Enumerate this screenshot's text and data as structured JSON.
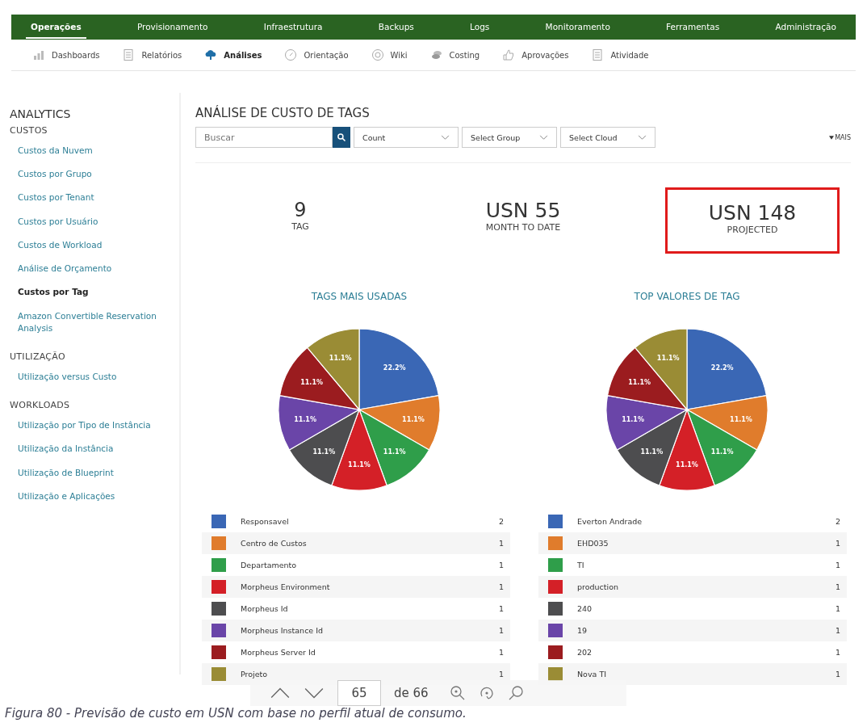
{
  "top_nav": [
    {
      "label": "Operações",
      "selected": true
    },
    {
      "label": "Provisionamento",
      "selected": false
    },
    {
      "label": "Infraestrutura",
      "selected": false
    },
    {
      "label": "Backups",
      "selected": false
    },
    {
      "label": "Logs",
      "selected": false
    },
    {
      "label": "Monitoramento",
      "selected": false
    },
    {
      "label": "Ferramentas",
      "selected": false
    },
    {
      "label": "Administração",
      "selected": false
    }
  ],
  "sub_nav": [
    {
      "label": "Dashboards",
      "kind": "chart",
      "selected": false
    },
    {
      "label": "Relatórios",
      "kind": "doc",
      "selected": false
    },
    {
      "label": "Análises",
      "kind": "cloud",
      "selected": true
    },
    {
      "label": "Orientação",
      "kind": "compass",
      "selected": false
    },
    {
      "label": "Wiki",
      "kind": "wiki",
      "selected": false
    },
    {
      "label": "Costing",
      "kind": "coins",
      "selected": false
    },
    {
      "label": "Aprovações",
      "kind": "thumb",
      "selected": false
    },
    {
      "label": "Atividade",
      "kind": "doc",
      "selected": false
    }
  ],
  "sidebar": {
    "title": "ANALYTICS",
    "sections": [
      {
        "heading": "CUSTOS",
        "items": [
          {
            "label": "Custos da Nuvem",
            "selected": false
          },
          {
            "label": "Custos por Grupo",
            "selected": false
          },
          {
            "label": "Custos por Tenant",
            "selected": false
          },
          {
            "label": "Custos por Usuário",
            "selected": false
          },
          {
            "label": "Custos de Workload",
            "selected": false
          },
          {
            "label": "Análise de Orçamento",
            "selected": false
          },
          {
            "label": "Custos por Tag",
            "selected": true
          },
          {
            "label": "Amazon Convertible Reservation Analysis",
            "selected": false
          }
        ]
      },
      {
        "heading": "UTILIZAÇÃO",
        "items": [
          {
            "label": "Utilização versus Custo",
            "selected": false
          }
        ]
      },
      {
        "heading": "WORKLOADS",
        "items": [
          {
            "label": "Utilização por Tipo de Instância",
            "selected": false
          },
          {
            "label": "Utilização da Instância",
            "selected": false
          },
          {
            "label": "Utilização de Blueprint",
            "selected": false
          },
          {
            "label": "Utilização e Aplicações",
            "selected": false
          }
        ]
      }
    ]
  },
  "content": {
    "title": "ANÁLISE DE CUSTO DE TAGS",
    "search": {
      "placeholder": "Buscar"
    },
    "selects": [
      "Count",
      "Select Group",
      "Select Cloud"
    ],
    "more_link": "MAIS",
    "stats": [
      {
        "value": "9",
        "label": "TAG",
        "highlighted": false
      },
      {
        "value": "USN 55",
        "label": "MONTH TO DATE",
        "highlighted": false
      },
      {
        "value": "USN 148",
        "label": "PROJECTED",
        "highlighted": true
      }
    ],
    "charts": [
      {
        "chart_data": {
          "type": "pie",
          "title": "TAGS MAIS USADAS",
          "categories": [
            "Responsavel",
            "Centro de Custos",
            "Departamento",
            "Morpheus Environment",
            "Morpheus Id",
            "Morpheus Instance Id",
            "Morpheus Server Id",
            "Projeto"
          ],
          "values": [
            22.2,
            11.1,
            11.1,
            11.1,
            11.1,
            11.1,
            11.1,
            11.1
          ],
          "data_labels": true,
          "value_labels": [
            "22.2%",
            "11.1%",
            "11.1%",
            "11.1%",
            "11.1%",
            "11.1%",
            "11.1%",
            "11.1%"
          ]
        },
        "legend": [
          {
            "count": "2",
            "color": "#3a67b5"
          },
          {
            "count": "1",
            "color": "#e07c2c"
          },
          {
            "count": "1",
            "color": "#2f9e4a"
          },
          {
            "count": "1",
            "color": "#d42027"
          },
          {
            "count": "1",
            "color": "#4d4d4f"
          },
          {
            "count": "1",
            "color": "#6a45a8"
          },
          {
            "count": "1",
            "color": "#9b1c1f"
          },
          {
            "count": "1",
            "color": "#9a8c35"
          }
        ]
      },
      {
        "chart_data": {
          "type": "pie",
          "title": "TOP VALORES DE TAG",
          "categories": [
            "Everton Andrade",
            "EHD035",
            "TI",
            "production",
            "240",
            "19",
            "202",
            "Nova TI"
          ],
          "values": [
            22.2,
            11.1,
            11.1,
            11.1,
            11.1,
            11.1,
            11.1,
            11.1
          ],
          "data_labels": true,
          "value_labels": [
            "22.2%",
            "11.1%",
            "11.1%",
            "11.1%",
            "11.1%",
            "11.1%",
            "11.1%",
            "11.1%"
          ]
        },
        "legend": [
          {
            "count": "2",
            "color": "#3a67b5"
          },
          {
            "count": "1",
            "color": "#e07c2c"
          },
          {
            "count": "1",
            "color": "#2f9e4a"
          },
          {
            "count": "1",
            "color": "#d42027"
          },
          {
            "count": "1",
            "color": "#4d4d4f"
          },
          {
            "count": "1",
            "color": "#6a45a8"
          },
          {
            "count": "1",
            "color": "#9b1c1f"
          },
          {
            "count": "1",
            "color": "#9a8c35"
          }
        ]
      }
    ]
  },
  "caption": "Figura 80 - Previsão de custo em USN com base no perfil atual de consumo.",
  "viewer_toolbar": {
    "page": "65",
    "of": "de 66"
  }
}
